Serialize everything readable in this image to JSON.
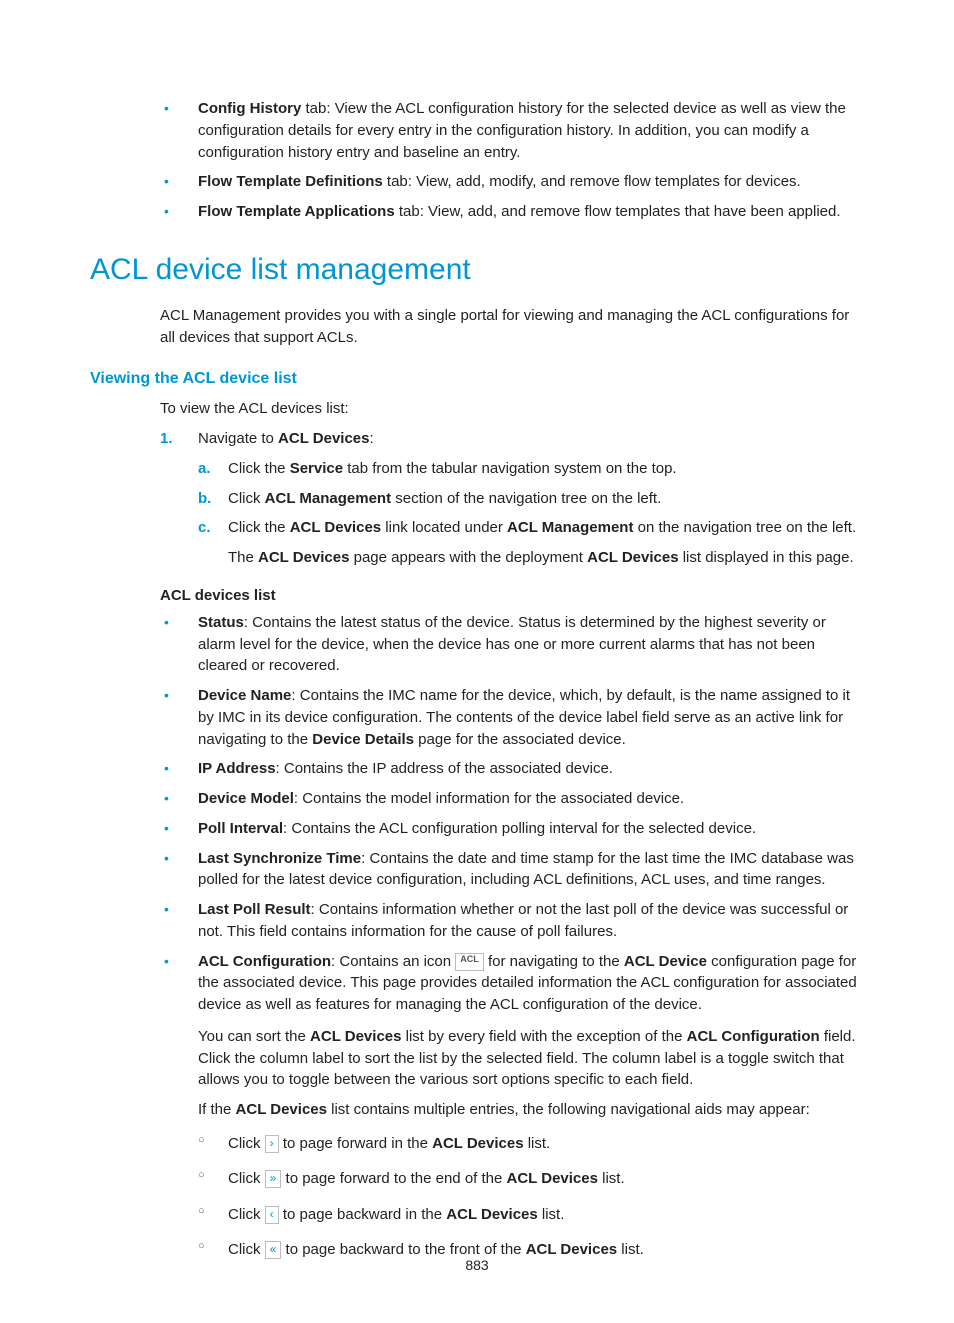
{
  "topBullets": [
    {
      "bold": "Config History",
      "tail": " tab: View the ACL configuration history for the selected device as well as view the configuration details for every entry in the configuration history. In addition, you can modify a configuration history entry and baseline an entry."
    },
    {
      "bold": "Flow Template Definitions",
      "tail": " tab: View, add, modify, and remove flow templates for devices."
    },
    {
      "bold": "Flow Template Applications",
      "tail": " tab: View, add, and remove flow templates that have been applied."
    }
  ],
  "h1": "ACL device list management",
  "intro": "ACL Management provides you with a single portal for viewing and managing the ACL configurations for all devices that support ACLs.",
  "h3": "Viewing the ACL device list",
  "introSub": "To view the ACL devices list:",
  "numItem": {
    "lead": "Navigate to ",
    "bold": "ACL Devices",
    "tail": ":"
  },
  "alpha": [
    {
      "pre": "Click the ",
      "b1": "Service",
      "post": " tab from the tabular navigation system on the top."
    },
    {
      "pre": "Click ",
      "b1": "ACL Management",
      "post": " section of the navigation tree on the left."
    }
  ],
  "alphaC": {
    "pre": "Click the ",
    "b1": "ACL Devices",
    "mid1": " link located under ",
    "b2": "ACL Management",
    "post": " on the navigation tree on the left."
  },
  "alphaCResult": {
    "pre": "The ",
    "b1": "ACL Devices",
    "mid1": " page appears with the deployment ",
    "b2": "ACL Devices",
    "post": " list displayed in this page."
  },
  "h4": "ACL devices list",
  "fields": [
    {
      "bold": "Status",
      "tail": ": Contains the latest status of the device. Status is determined by the highest severity or alarm level for the device, when the device has one or more current alarms that has not been cleared or recovered."
    },
    {
      "bold": "IP Address",
      "tail": ": Contains the IP address of the associated device."
    },
    {
      "bold": "Device Model",
      "tail": ": Contains the model information for the associated device."
    },
    {
      "bold": "Poll Interval",
      "tail": ": Contains the ACL configuration polling interval for the selected device."
    },
    {
      "bold": "Last Synchronize Time",
      "tail": ": Contains the date and time stamp for the last time the IMC database was polled for the latest device configuration, including ACL definitions, ACL uses, and time ranges."
    },
    {
      "bold": "Last Poll Result",
      "tail": ": Contains information whether or not the last poll of the device was successful or not. This field contains information for the cause of poll failures."
    }
  ],
  "deviceName": {
    "bold": "Device Name",
    "part1": ": Contains the IMC name for the device, which, by default, is the name assigned to it by IMC in its device configuration. The contents of the device label field serve as an active link for navigating to the ",
    "b2": "Device Details",
    "part2": " page for the associated device."
  },
  "aclConfig": {
    "bold": "ACL Configuration",
    "part1": ": Contains an icon ",
    "part2": " for navigating to the ",
    "b2": "ACL Device",
    "part3": " configuration page for the associated device. This page provides detailed information the ACL configuration for associated device as well as features for managing the ACL configuration of the device."
  },
  "sortPara": {
    "pre": "You can sort the ",
    "b1": "ACL Devices",
    "mid1": " list by every field with the exception of the ",
    "b2": "ACL Configuration",
    "post": " field. Click the column label to sort the list by the selected field. The column label is a toggle switch that allows you to toggle between the various sort options specific to each field."
  },
  "navPara": {
    "pre": "If the ",
    "b1": "ACL Devices",
    "post": " list contains multiple entries, the following navigational aids may appear:"
  },
  "navAids": [
    {
      "icon": "›",
      "pre": "Click ",
      "mid": " to page forward in the ",
      "bold": "ACL Devices",
      "post": " list."
    },
    {
      "icon": "»",
      "pre": "Click ",
      "mid": " to page forward to the end of the ",
      "bold": "ACL Devices",
      "post": " list."
    },
    {
      "icon": "‹",
      "pre": "Click ",
      "mid": " to page backward in the ",
      "bold": "ACL Devices",
      "post": " list."
    },
    {
      "icon": "«",
      "pre": "Click ",
      "mid": " to page backward to the front of the ",
      "bold": "ACL Devices",
      "post": " list."
    }
  ],
  "pageNumber": "883"
}
